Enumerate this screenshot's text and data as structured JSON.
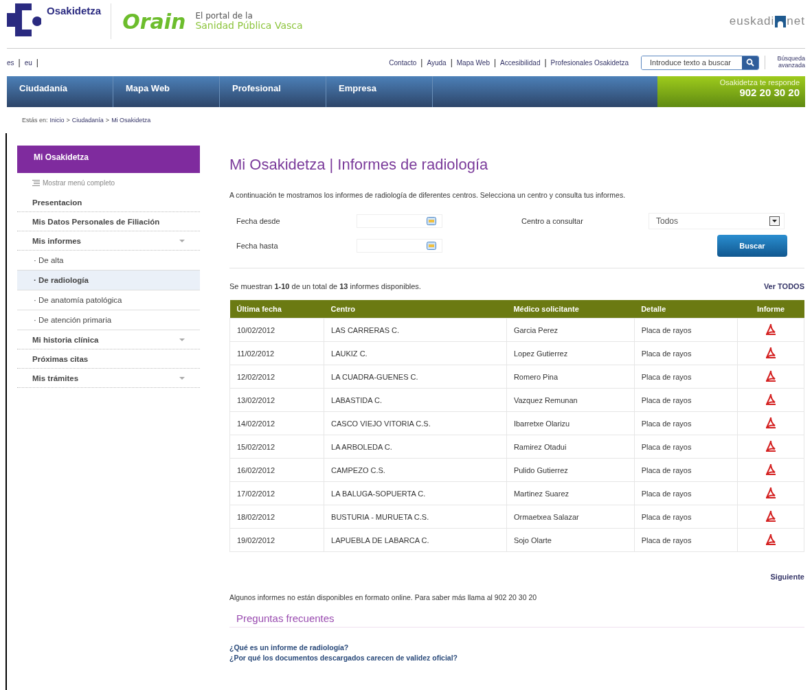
{
  "header": {
    "brand": "Osakidetza",
    "portal_logo": "Orain",
    "tagline_1": "El portal de la",
    "tagline_2": "Sanidad Pública Vasca",
    "partner_logo_1": "euskadi",
    "partner_logo_2": "net"
  },
  "languages": [
    {
      "label": "es",
      "separator": "|"
    },
    {
      "label": "eu",
      "separator": "|"
    }
  ],
  "utility_links": [
    {
      "label": "Contacto"
    },
    {
      "separator": "|",
      "label": "Ayuda"
    },
    {
      "separator": "|",
      "label": "Mapa Web"
    },
    {
      "separator": "|",
      "label": "Accesibilidad"
    },
    {
      "separator": "|",
      "label": "Profesionales Osakidetza"
    }
  ],
  "search": {
    "placeholder": "Introduce texto a buscar",
    "advanced": "Búsqueda avanzada"
  },
  "nav": {
    "items": [
      "Ciudadanía",
      "Mapa Web",
      "Profesional",
      "Empresa"
    ],
    "promo_label": "Osakidetza te responde",
    "promo_phone": "902 20 30 20"
  },
  "breadcrumb": {
    "label": "Estás en:",
    "separator": ">",
    "items": [
      "Inicio",
      "Ciudadanía",
      "Mi Osakidetza"
    ]
  },
  "sidebar": {
    "title": "Mi Osakidetza",
    "toggle": "Mostrar menú completo",
    "items": [
      {
        "label": "Presentacion",
        "expandable": false
      },
      {
        "label": "Mis Datos Personales de Filiación",
        "expandable": false
      },
      {
        "label": "Mis informes",
        "expandable": true,
        "children": [
          {
            "bullet": "·",
            "label": "De alta",
            "selected": false
          },
          {
            "bullet": "·",
            "label": "De radiología",
            "selected": true
          },
          {
            "bullet": "·",
            "label": "De anatomía patológica",
            "selected": false
          },
          {
            "bullet": "·",
            "label": "De atención primaria",
            "selected": false
          }
        ]
      },
      {
        "label": "Mi historia clínica",
        "expandable": true
      },
      {
        "label": "Próximas citas",
        "expandable": false
      },
      {
        "label": "Mis trámites",
        "expandable": true
      }
    ]
  },
  "main": {
    "title": "Mi Osakidetza | Informes de radiología",
    "intro": "A continuación te mostramos los informes de radiología de diferentes centros. Selecciona un centro y consulta tus informes.",
    "date_from_label": "Fecha desde",
    "date_to_label": "Fecha hasta",
    "center_label": "Centro a consultar",
    "center_value": "Todos",
    "search_button": "Buscar",
    "summary": "Se muestran **1-10** de un total de **13** informes disponibles.",
    "view_all": "Ver TODOS",
    "table": {
      "columns": [
        "Última fecha",
        "Centro",
        "Médico solicitante",
        "Detalle",
        "Informe"
      ],
      "rows": [
        [
          "10/02/2012",
          "LAS CARRERAS C.",
          "Garcia Perez",
          "Placa de rayos"
        ],
        [
          "11/02/2012",
          "LAUKIZ C.",
          "Lopez Gutierrez",
          "Placa de rayos"
        ],
        [
          "12/02/2012",
          "LA CUADRA-GUENES C.",
          "Romero Pina",
          "Placa de rayos"
        ],
        [
          "13/02/2012",
          "LABASTIDA C.",
          "Vazquez Remunan",
          "Placa de rayos"
        ],
        [
          "14/02/2012",
          "CASCO VIEJO VITORIA C.S.",
          "Ibarretxe Olarizu",
          "Placa de rayos"
        ],
        [
          "15/02/2012",
          "LA ARBOLEDA C.",
          "Ramirez Otadui",
          "Placa de rayos"
        ],
        [
          "16/02/2012",
          "CAMPEZO C.S.",
          "Pulido Gutierrez",
          "Placa de rayos"
        ],
        [
          "17/02/2012",
          "LA BALUGA-SOPUERTA C.",
          "Martinez Suarez",
          "Placa de rayos"
        ],
        [
          "18/02/2012",
          "BUSTURIA - MURUETA C.S.",
          "Ormaetxea Salazar",
          "Placa de rayos"
        ],
        [
          "19/02/2012",
          "LAPUEBLA DE LABARCA C.",
          "Sojo Olarte",
          "Placa de rayos"
        ]
      ]
    },
    "next": "Siguiente",
    "note": "Algunos informes no están disponibles en formato online. Para saber más llama al 902 20 30 20",
    "faq_title": "Preguntas frecuentes",
    "faq": [
      "¿Qué es un informe de radiología?",
      "¿Por qué los documentos descargados carecen de validez oficial?"
    ]
  }
}
